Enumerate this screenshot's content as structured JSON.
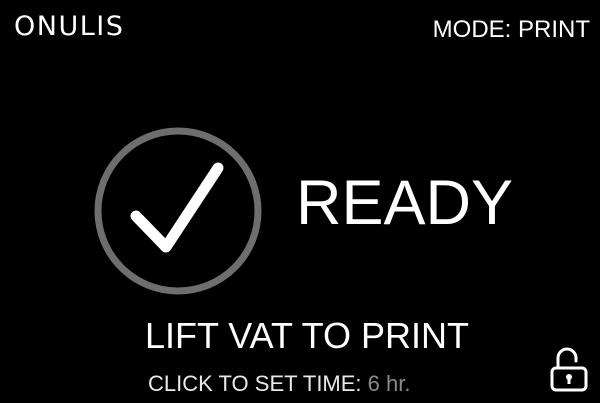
{
  "header": {
    "brand": "ONULIS",
    "mode_text": "MODE: PRINT"
  },
  "status": {
    "icon": "checkmark-circle-icon",
    "label": "READY"
  },
  "instruction": "LIFT VAT TO PRINT",
  "timer": {
    "label": "CLICK TO SET TIME:",
    "value": "6 hr."
  },
  "lock": {
    "icon": "unlocked-padlock-icon"
  },
  "colors": {
    "background": "#000000",
    "text": "#ffffff",
    "ring": "#6e6e6e",
    "muted": "#8a8a8a"
  }
}
